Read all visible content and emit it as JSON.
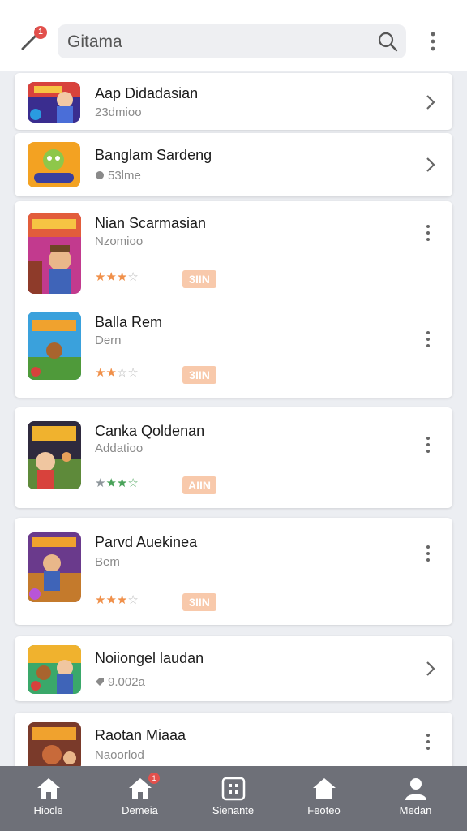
{
  "header": {
    "search_text": "Gitama",
    "tool_badge": "1"
  },
  "colors": {
    "accent": "#f0904a",
    "badge": "#e2504c",
    "nav_bg": "#6e7078",
    "get_button": "#f8c9ab"
  },
  "items": [
    {
      "title": "Aap Didadasian",
      "sub": "23dmioo",
      "action": "chevron-right-icon"
    },
    {
      "title": "Banglam Sardeng",
      "sub": "53lme",
      "action": "chevron-right-icon"
    },
    {
      "title": "Nian Scarmasian",
      "sub": "Nzomioo",
      "stars_filled": 3,
      "button": "3IIN",
      "action": "more-vert-icon"
    },
    {
      "title": "Balla Rem",
      "sub": "Dern",
      "stars_filled": 2,
      "button": "3IIN",
      "action": "more-vert-icon"
    },
    {
      "title": "Canka Qoldenan",
      "sub": "Addatioo",
      "stars_filled": 3,
      "button": "AIIN",
      "action": "more-vert-icon"
    },
    {
      "title": "Parvd Auekinea",
      "sub": "Bem",
      "stars_filled": 3,
      "button": "3IIN",
      "action": "more-vert-icon"
    },
    {
      "title": "Noiiongel laudan",
      "sub": "9.002a",
      "action": "chevron-right-icon"
    },
    {
      "title": "Raotan Miaaa",
      "sub": "Naoorlod",
      "action": "more-vert-icon"
    }
  ],
  "nav": [
    {
      "label": "Hiocle",
      "icon": "home-icon"
    },
    {
      "label": "Demeia",
      "icon": "home-icon",
      "badge": "1"
    },
    {
      "label": "Sienante",
      "icon": "grid-icon"
    },
    {
      "label": "Feoteo",
      "icon": "home-icon"
    },
    {
      "label": "Medan",
      "icon": "person-icon"
    }
  ]
}
